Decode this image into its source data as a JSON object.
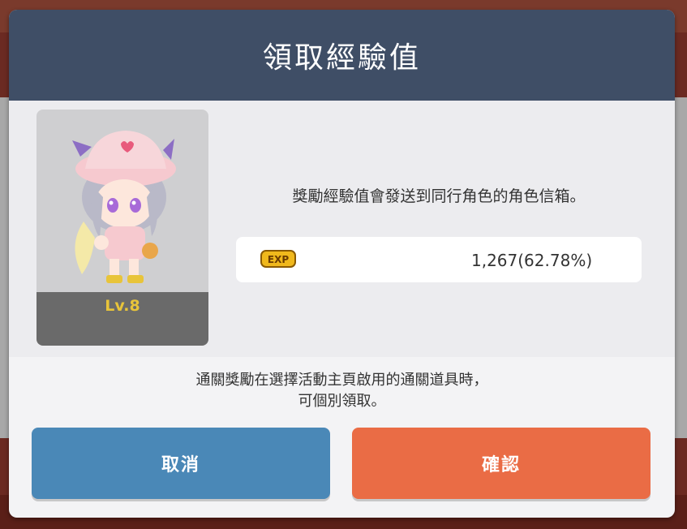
{
  "dialog": {
    "title": "領取經驗值",
    "description": "獎勵經驗值會發送到同行角色的角色信箱。",
    "exp": {
      "icon_label": "EXP",
      "value": "1,267(62.78%)"
    },
    "character": {
      "level": "Lv.8"
    },
    "note_lines": [
      "通關獎勵在選擇活動主頁啟用的通關道具時，",
      "可個別領取。"
    ],
    "buttons": {
      "cancel": "取消",
      "confirm": "確認"
    }
  },
  "colors": {
    "header": "#3f4e66",
    "cancel_button": "#4a88b7",
    "confirm_button": "#ea6c45",
    "level_text": "#e8c43a"
  }
}
